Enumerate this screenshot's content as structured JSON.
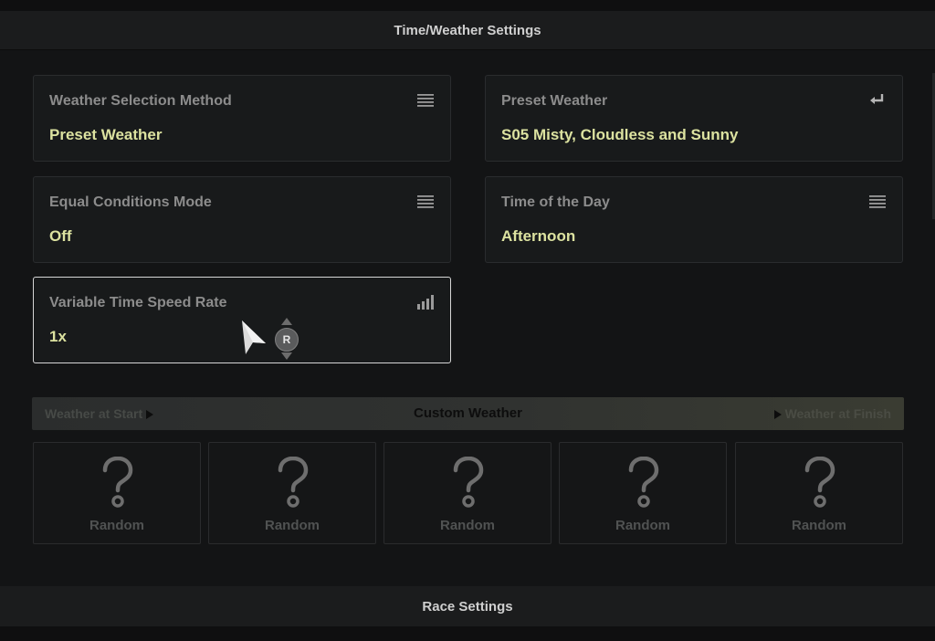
{
  "header": {
    "title": "Time/Weather Settings"
  },
  "settings": {
    "weather_method": {
      "label": "Weather Selection Method",
      "value": "Preset Weather",
      "icon": "list-icon"
    },
    "preset_weather": {
      "label": "Preset Weather",
      "value": "S05 Misty, Cloudless and Sunny",
      "icon": "enter-icon"
    },
    "equal_conditions": {
      "label": "Equal Conditions Mode",
      "value": "Off",
      "icon": "list-icon"
    },
    "time_of_day": {
      "label": "Time of the Day",
      "value": "Afternoon",
      "icon": "list-icon"
    },
    "time_speed": {
      "label": "Variable Time Speed Rate",
      "value": "1x",
      "icon": "signal-bars-icon"
    }
  },
  "custom_weather": {
    "left": "Weather at Start",
    "title": "Custom Weather",
    "right": "Weather at Finish",
    "slots": [
      "Random",
      "Random",
      "Random",
      "Random",
      "Random"
    ]
  },
  "stick_hint": {
    "label": "R"
  },
  "footer": {
    "title": "Race Settings"
  },
  "colors": {
    "value_accent": "#dce2a0",
    "label": "#8c8c8c",
    "focus_border": "#d6d6d6"
  }
}
